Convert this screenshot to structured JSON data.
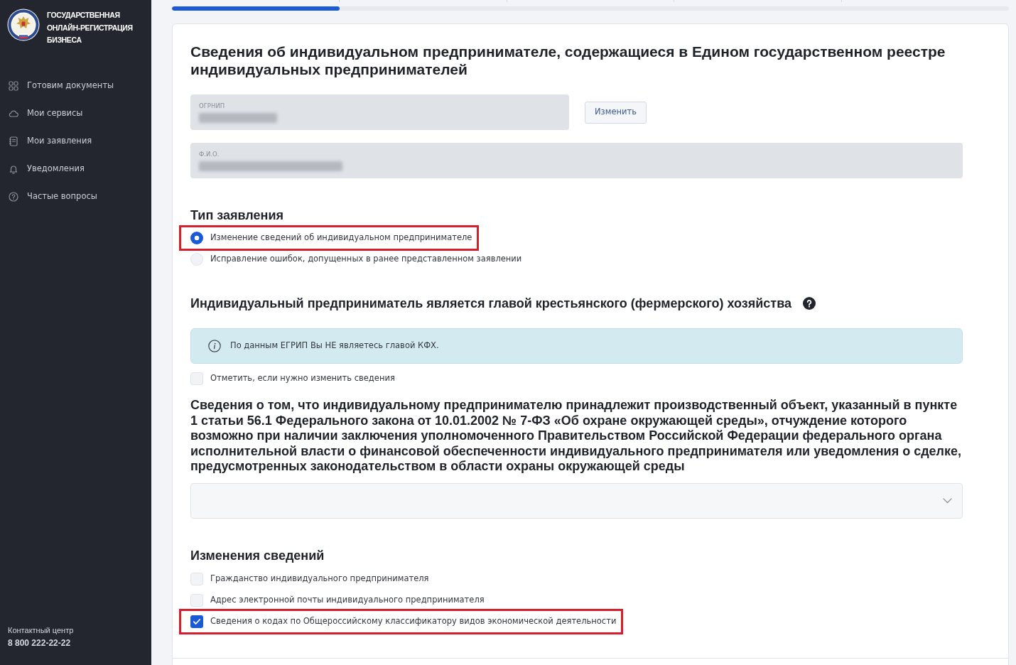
{
  "sidebar": {
    "logo_lines": [
      "ГОСУДАРСТВЕННАЯ",
      "ОНЛАЙН-РЕГИСТРАЦИЯ",
      "БИЗНЕСА"
    ],
    "items": [
      {
        "label": "Готовим документы"
      },
      {
        "label": "Мои сервисы"
      },
      {
        "label": "Мои заявления"
      },
      {
        "label": "Уведомления"
      },
      {
        "label": "Частые вопросы"
      }
    ],
    "contact": {
      "label": "Контактный центр",
      "phone": "8 800 222-22-22"
    }
  },
  "progress": {
    "level": 0.2
  },
  "form": {
    "title": "Сведения об индивидуальном предпринимателе, содержащиеся в Едином государственном реестре индивидуальных предпринимателей",
    "registry_fields": [
      {
        "label": "ОГРНИП",
        "action": "Изменить"
      },
      {
        "label": "Ф.И.О."
      }
    ],
    "application_type": {
      "heading": "Тип заявления",
      "options": [
        {
          "label": "Изменение сведений об индивидуальном предпринимателе",
          "selected": true,
          "highlighted": true
        },
        {
          "label": "Исправление ошибок, допущенных в ранее представленном заявлении",
          "selected": false,
          "highlighted": false
        }
      ]
    },
    "farm_head": {
      "heading": "Индивидуальный предприниматель является главой крестьянского (фермерского) хозяйства",
      "notice": "По данным ЕГРИП Вы НЕ являетесь главой КФХ.",
      "checkbox": {
        "label": "Отметить, если нужно изменить сведения",
        "checked": false
      }
    },
    "production_object": {
      "heading": "Сведения о том, что индивидуальному предпринимателю принадлежит производственный объект, указанный в пункте 1 статьи 56.1 Федерального закона от 10.01.2002 № 7-ФЗ «Об охране окружающей среды», отчуждение которого возможно при наличии заключения уполномоченного Правительством Российской Федерации федерального органа исполнительной власти о финансовой обеспеченности индивидуального предпринимателя или уведомления о сделке, предусмотренных законодательством в области охраны окружающей среды"
    },
    "changes": {
      "heading": "Изменения сведений",
      "options": [
        {
          "label": "Гражданство индивидуального предпринимателя",
          "checked": false,
          "highlighted": false
        },
        {
          "label": "Адрес электронной почты индивидуального предпринимателя",
          "checked": false,
          "highlighted": false
        },
        {
          "label": "Сведения о кодах по Общероссийскому классификатору видов экономической деятельности",
          "checked": true,
          "highlighted": true
        }
      ]
    }
  }
}
